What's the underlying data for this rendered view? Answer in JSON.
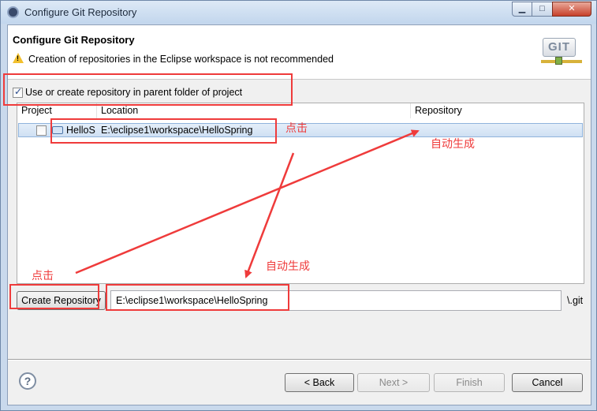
{
  "window": {
    "title": "Configure Git Repository",
    "buttons": {
      "minimize": "▁",
      "maximize": "□",
      "close": "✕"
    }
  },
  "header": {
    "title": "Configure Git Repository",
    "warning_icon": "warning-icon",
    "warning_text": "Creation of repositories in the Eclipse workspace is not recommended",
    "logo_text": "GIT"
  },
  "options": {
    "use_parent_label": "Use or create repository in parent folder of project",
    "use_parent_checked": true
  },
  "table": {
    "columns": [
      "Project",
      "Location",
      "Repository"
    ],
    "rows": [
      {
        "project": "HelloS",
        "location": "E:\\eclipse1\\workspace\\HelloSpring",
        "repository": "",
        "checked": false
      }
    ]
  },
  "create": {
    "button_label": "Create Repository",
    "path_value": "E:\\eclipse1\\workspace\\HelloSpring",
    "suffix": "\\.git"
  },
  "footer": {
    "help_icon": "?",
    "back_label": "< Back",
    "next_label": "Next >",
    "finish_label": "Finish",
    "cancel_label": "Cancel"
  },
  "annotations": {
    "click_1": "点击",
    "auto_1": "自动生成",
    "click_2": "点击",
    "auto_2": "自动生成",
    "color": "#ef3b3b"
  }
}
